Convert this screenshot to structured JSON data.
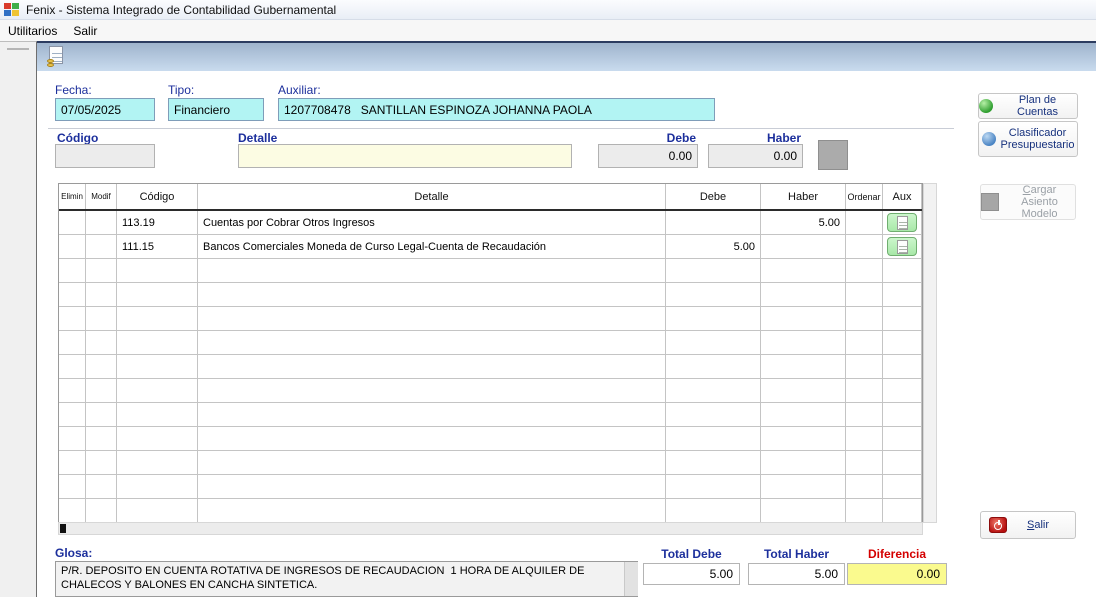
{
  "window": {
    "title": "Fenix - Sistema Integrado de Contabilidad Gubernamental"
  },
  "menu": {
    "utilitarios": "Utilitarios",
    "salir": "Salir"
  },
  "header_fields": {
    "fecha_label": "Fecha:",
    "fecha_value": "07/05/2025",
    "tipo_label": "Tipo:",
    "tipo_value": "Financiero",
    "auxiliar_label": "Auxiliar:",
    "auxiliar_value": "1207708478   SANTILLAN ESPINOZA JOHANNA PAOLA"
  },
  "entry": {
    "codigo_label": "Código",
    "codigo_value": "",
    "detalle_label": "Detalle",
    "detalle_value": "",
    "debe_label": "Debe",
    "debe_value": "0.00",
    "haber_label": "Haber",
    "haber_value": "0.00"
  },
  "table": {
    "columns": {
      "elimin": "Elimin",
      "modif": "Modif",
      "codigo": "Código",
      "detalle": "Detalle",
      "debe": "Debe",
      "haber": "Haber",
      "ordenar": "Ordenar",
      "aux": "Aux"
    },
    "rows": [
      {
        "codigo": "113.19",
        "detalle": "Cuentas por Cobrar Otros Ingresos",
        "debe": "",
        "haber": "5.00"
      },
      {
        "codigo": "111.15",
        "detalle": "Bancos Comerciales Moneda de Curso Legal-Cuenta de Recaudación",
        "debe": "5.00",
        "haber": ""
      }
    ],
    "empty_row_count": 11
  },
  "side_buttons": {
    "plan_de_cuentas": "Plan de Cuentas",
    "clasificador_line1": "Clasificador",
    "clasificador_line2": "Presupuestario",
    "cargar_accel": "C",
    "cargar_rest": "argar Asiento",
    "cargar_line2": "Modelo",
    "salir_accel": "S",
    "salir_rest": "alir"
  },
  "footer": {
    "glosa_label": "Glosa:",
    "glosa_value": "P/R. DEPOSITO EN CUENTA ROTATIVA DE INGRESOS DE RECAUDACION  1 HORA DE ALQUILER DE CHALECOS Y BALONES EN CANCHA SINTETICA.",
    "total_debe_label": "Total Debe",
    "total_debe_value": "5.00",
    "total_haber_label": "Total Haber",
    "total_haber_value": "5.00",
    "diferencia_label": "Diferencia",
    "diferencia_value": "0.00"
  },
  "colors": {
    "label_navy": "#1c2f9c",
    "field_cyan": "#b2f4f3",
    "field_yellow": "#fcfce3",
    "diff_yellow": "#fafa8e",
    "diferencia_red": "#d40000",
    "aux_green": "#a8e8a8",
    "toolbar_top": "#9fb4cd",
    "toolbar_bottom": "#c9dbee"
  }
}
